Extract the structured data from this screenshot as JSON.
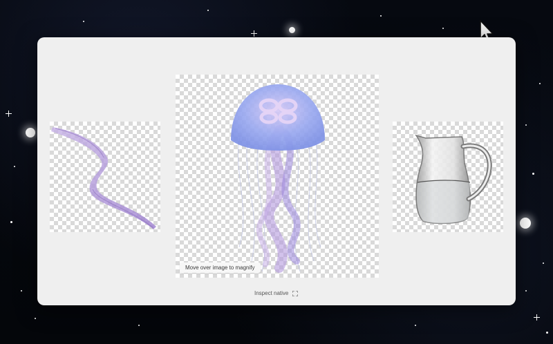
{
  "viewer": {
    "magnify_hint": "Move over image to magnify",
    "inspect_label": "Inspect native",
    "inspect_icon": "expand-icon"
  },
  "images": [
    {
      "subject": "purple-silk-ribbon",
      "position": "left"
    },
    {
      "subject": "blue-purple-jellyfish",
      "position": "center"
    },
    {
      "subject": "glass-water-pitcher",
      "position": "right"
    }
  ],
  "colors": {
    "panel_bg": "#efefef",
    "backdrop": "#05070c",
    "jellyfish_bell": "#8fa3f0",
    "ribbon": "#b29ad6",
    "checker": "#d9d9d9"
  }
}
